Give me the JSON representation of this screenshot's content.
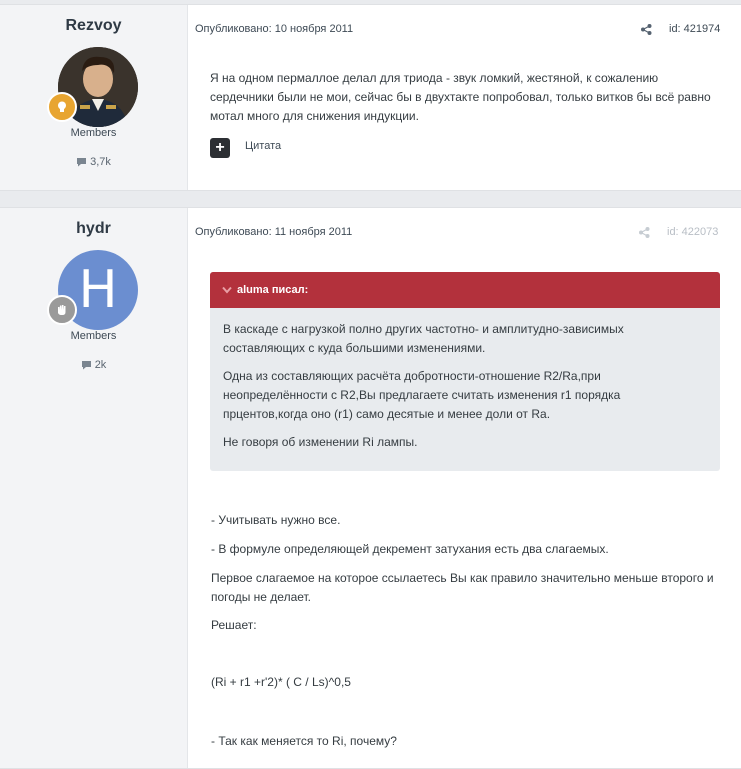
{
  "posts": [
    {
      "author": "Rezvoy",
      "group": "Members",
      "reputation": "3,7k",
      "published": "Опубликовано: 10 ноября 2011",
      "post_id": "id: 421974",
      "body": "Я на одном пермаллое делал для триода - звук ломкий, жестяной, к сожалению сердечники были не мои, сейчас бы в двухтакте попробовал, только витков бы всё равно мотал много для снижения индукции.",
      "quote_button": "+",
      "quote_label": "Цитата",
      "avatar_icon": "portrait-avatar",
      "badge_icon": "lightbulb-icon",
      "badge_color": "#e8a531"
    },
    {
      "author": "hydr",
      "group": "Members",
      "reputation": "2k",
      "published": "Опубликовано: 11 ноября 2011",
      "post_id": "id: 422073",
      "avatar_letter": "H",
      "avatar_color": "#6b8ed0",
      "badge_icon": "hand-icon",
      "badge_color": "#9a9a9a",
      "quote": {
        "header": "aluma писал:",
        "paragraphs": [
          "В каскаде с нагрузкой полно других частотно- и амплитудно-зависимых составляющих с куда большими изменениями.",
          "Одна из составляющих расчёта добротности-отношение R2/Ra,при неопределённости с R2,Вы предлагаете считать изменения r1 порядка прцентов,когда оно (r1) само десятые и менее доли от Ra.",
          "Не говоря об изменении Ri лампы."
        ]
      },
      "reply": [
        "- Учитывать нужно все.",
        "- В формуле определяющей декремент затухания есть два слагаемых.",
        "Первое слагаемое на которое ссылаетесь Вы как правило значительно меньше второго и погоды не делает.",
        "Решает:",
        "(Ri + r1 +r'2)* ( C / Ls)^0,5",
        "- Так как меняется то Ri, почему?"
      ]
    }
  ],
  "colors": {
    "quote_header": "#b3313c",
    "quote_bg": "#e8ebee",
    "page_bg": "#e9ebee"
  }
}
